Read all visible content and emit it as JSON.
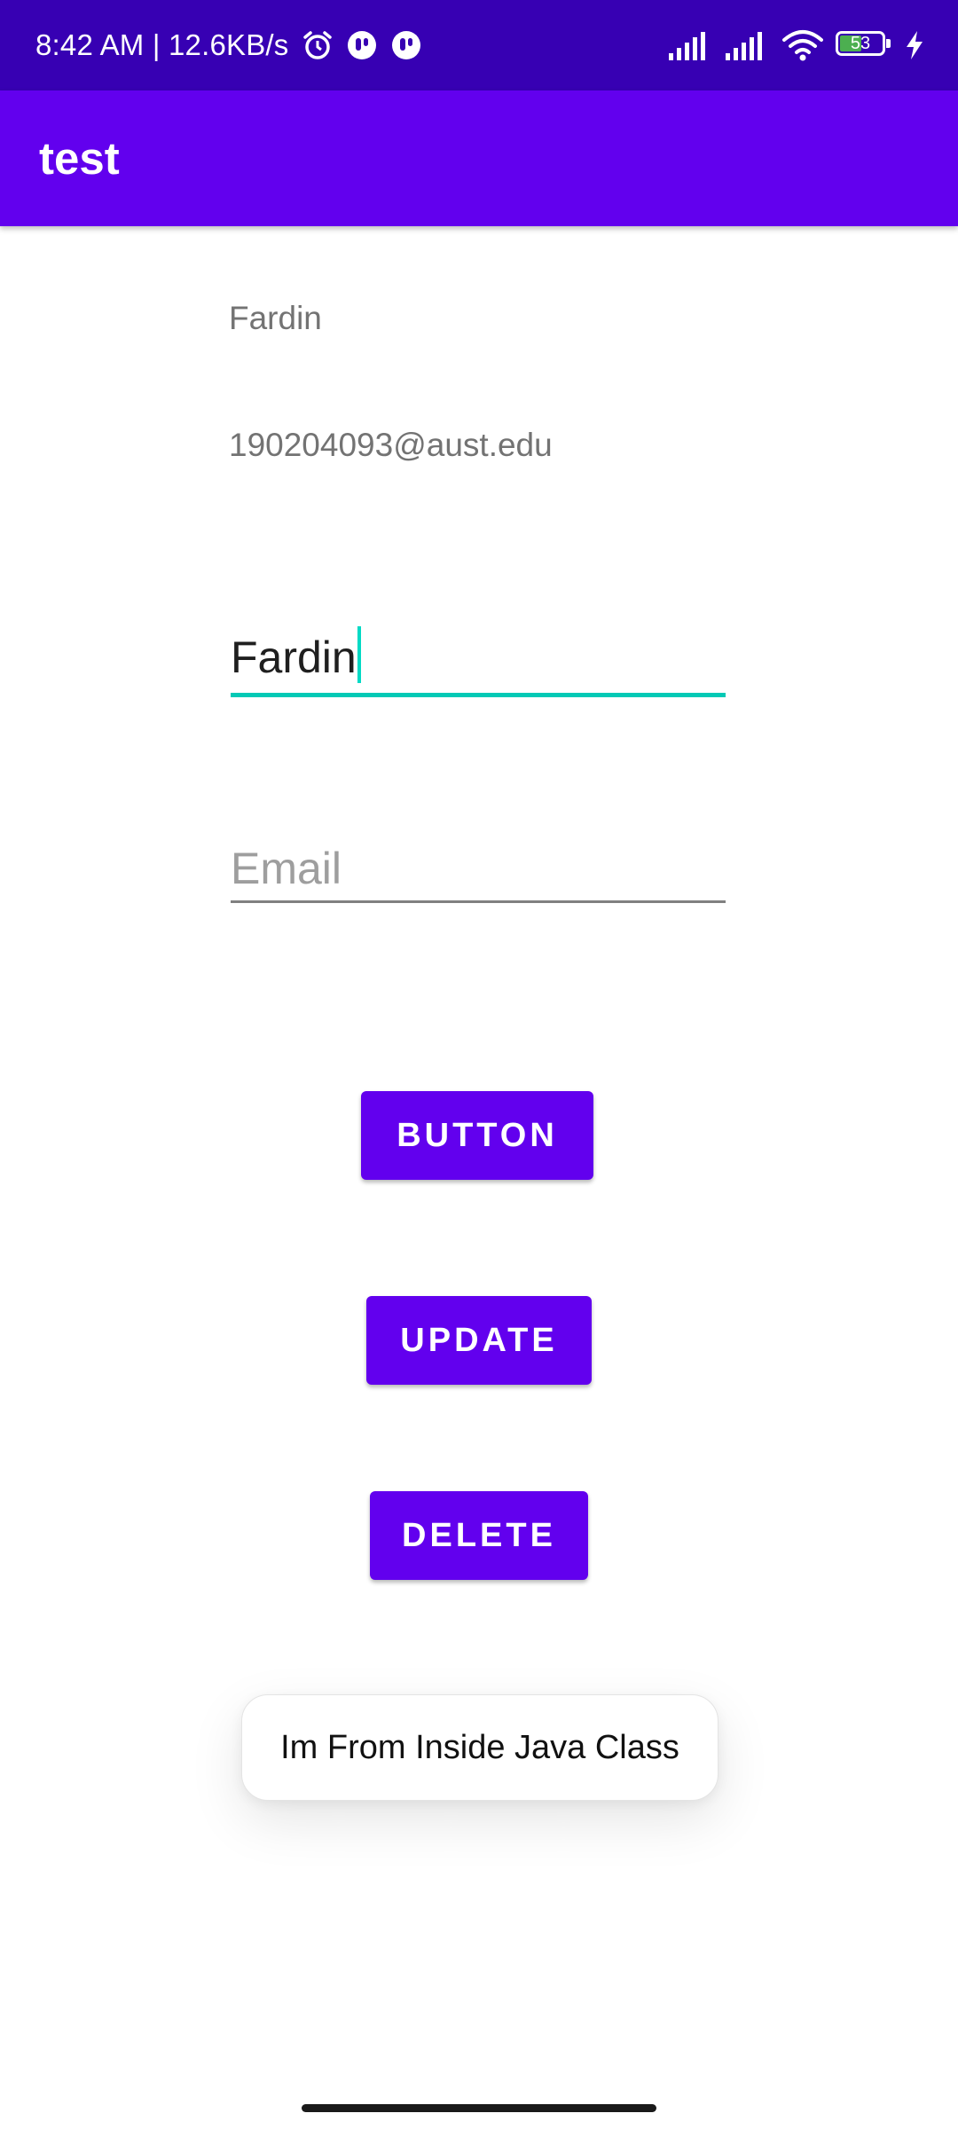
{
  "status_bar": {
    "time_speed": "8:42 AM | 12.6KB/s",
    "battery_level": "53",
    "left_icons": [
      "alarm-icon",
      "notification-app-icon",
      "notification-app-icon"
    ],
    "right_icons": [
      "signal-bars-icon",
      "signal-bars-icon",
      "wifi-icon",
      "battery-icon",
      "charging-bolt-icon"
    ],
    "background": "#3700B3"
  },
  "app_bar": {
    "title": "test",
    "background": "#6200EE"
  },
  "content": {
    "name_text": "Fardin",
    "email_text": "190204093@aust.edu",
    "name_input_value": "Fardin",
    "email_input_placeholder": "Email",
    "accent_color": "#03DAC5"
  },
  "buttons": {
    "button_label": "BUTTON",
    "update_label": "UPDATE",
    "delete_label": "DELETE",
    "color": "#6200EE"
  },
  "toast": {
    "message": "Im From Inside Java Class"
  }
}
